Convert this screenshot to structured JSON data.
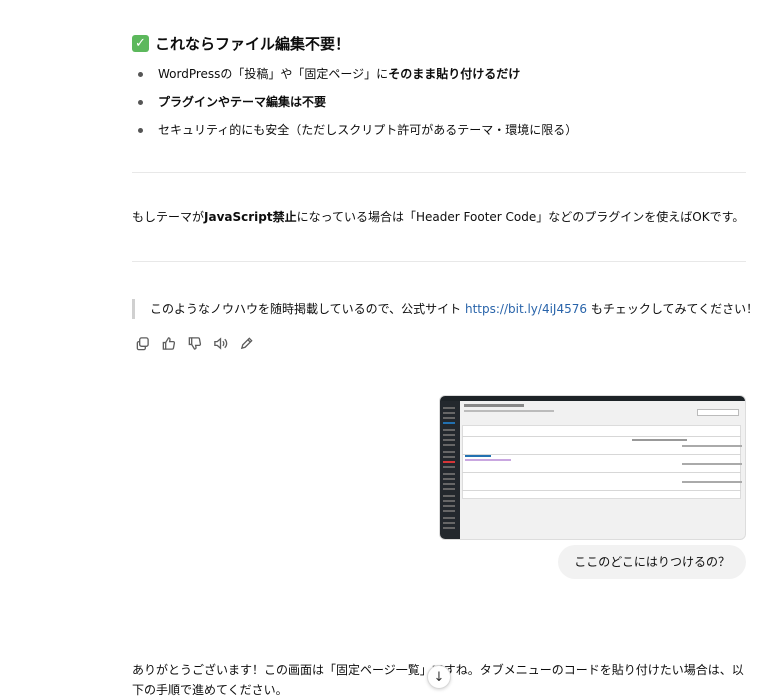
{
  "section": {
    "check_icon": "✓",
    "heading": "これならファイル編集不要！"
  },
  "bullets": [
    {
      "pre": "WordPressの「投稿」や「固定ページ」に",
      "bold": "そのまま貼り付けるだけ",
      "post": ""
    },
    {
      "pre": "",
      "bold": "プラグインやテーマ編集は不要",
      "post": ""
    },
    {
      "pre": "セキュリティ的にも安全（ただしスクリプト許可があるテーマ・環境に限る）",
      "bold": "",
      "post": ""
    }
  ],
  "note": {
    "pre": "もしテーマが",
    "bold": "JavaScript禁止",
    "post": "になっている場合は「Header Footer Code」などのプラグインを使えばOKです。"
  },
  "quote": {
    "pre": "このようなノウハウを随時掲載しているので、公式サイト ",
    "link": "https://bit.ly/4iJ4576",
    "post": " もチェックしてみてください！"
  },
  "actions": [
    "copy-icon",
    "thumbs-up-icon",
    "thumbs-down-icon",
    "read-aloud-icon",
    "edit-icon"
  ],
  "user_message": "ここのどこにはりつけるの？",
  "answer_text": "ありがとうございます！この画面は「固定ページ一覧」ですね。タブメニューのコードを貼り付けたい場合は、以下の手順で進めてください。",
  "scroll_icon": "↓"
}
